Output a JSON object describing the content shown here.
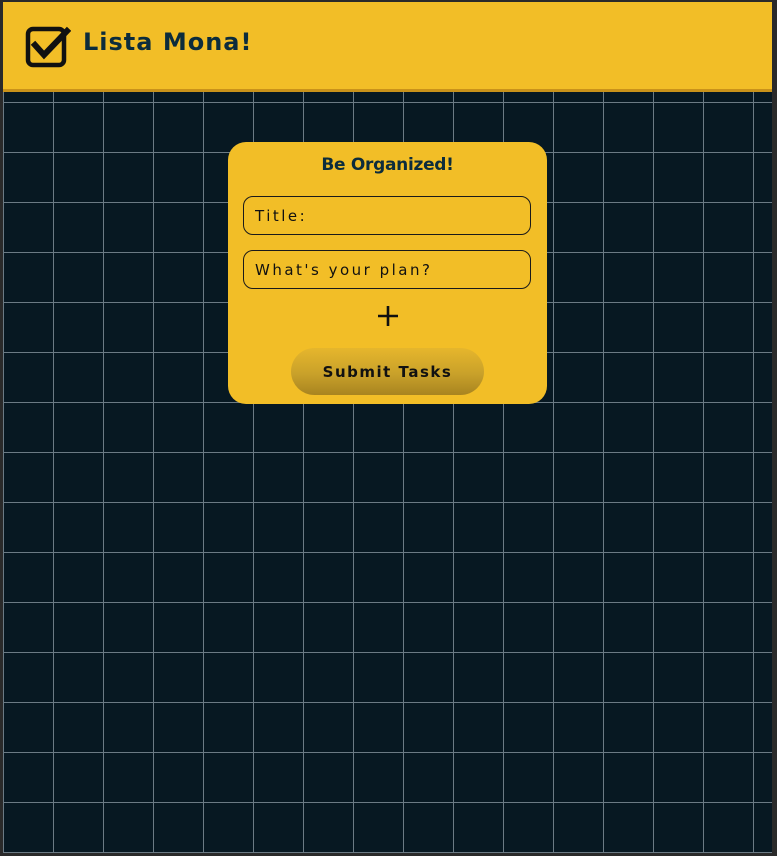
{
  "header": {
    "title": "Lista Mona!",
    "logo_icon": "checkbox-checked-icon"
  },
  "card": {
    "heading": "Be Organized!",
    "title_field": {
      "placeholder": "Title:",
      "value": ""
    },
    "plan_field": {
      "placeholder": "What's your plan?",
      "value": ""
    },
    "add_button_icon": "plus-icon",
    "submit_label": "Submit Tasks"
  },
  "colors": {
    "accent": "#f2be27",
    "background": "#071822",
    "grid_line": "#6b7a84",
    "heading_text": "#0c2c3c"
  }
}
